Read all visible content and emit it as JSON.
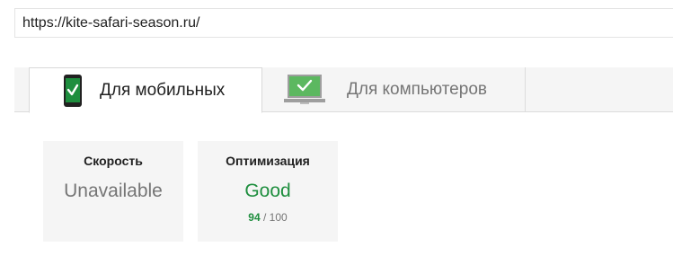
{
  "url_bar": {
    "value": "https://kite-safari-season.ru/"
  },
  "tabs": [
    {
      "label": "Для мобильных",
      "icon": "mobile-phone-check-icon",
      "active": true
    },
    {
      "label": "Для компьютеров",
      "icon": "desktop-monitor-check-icon",
      "active": false
    }
  ],
  "cards": {
    "speed": {
      "title": "Скорость",
      "value": "Unavailable"
    },
    "optimization": {
      "title": "Оптимизация",
      "value": "Good",
      "score": "94",
      "score_max": "/ 100"
    }
  },
  "colors": {
    "good": "#1e8e3e",
    "muted": "#757575",
    "panel": "#f5f5f5"
  }
}
